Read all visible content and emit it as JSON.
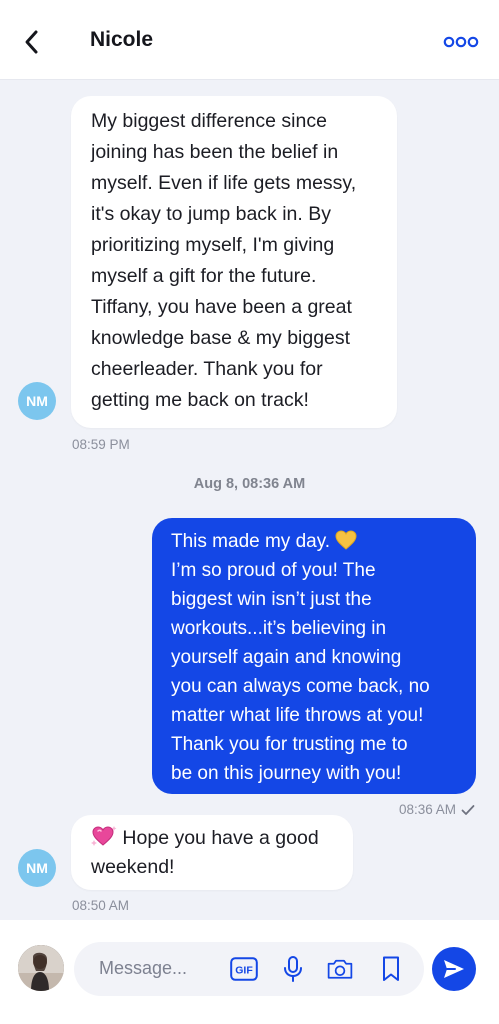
{
  "header": {
    "title": "Nicole",
    "back_icon": "chevron-left-icon",
    "more_icon": "more-dots-icon",
    "accent": "#1447e6"
  },
  "messages": [
    {
      "direction": "incoming",
      "lines": [
        "My biggest difference since",
        "joining has been the belief in",
        "myself. Even if life gets messy,",
        "it's okay to jump back in. By",
        "prioritizing myself, I'm giving",
        "myself a gift for the future.",
        "Tiffany, you have been a great",
        "knowledge base & my biggest",
        "cheerleader. Thank you for",
        "getting me back on track!"
      ],
      "avatar_initials": "NM",
      "time": "08:59 PM"
    },
    {
      "direction": "outgoing",
      "lines": [
        "This made my day.",
        "I’m so proud of you! The",
        "biggest win isn’t just the",
        "workouts...it’s believing in",
        "yourself again and knowing",
        "you can always come back, no",
        "matter what life throws at you!",
        "Thank you for trusting me to",
        "be on this journey with you!"
      ],
      "emoji": "yellow-heart-icon",
      "time": "08:36 AM",
      "status_icon": "checkmark-icon"
    },
    {
      "direction": "incoming",
      "lines": [
        "Hope you have a good",
        "weekend!"
      ],
      "emoji": "sparkling-heart-icon",
      "avatar_initials": "NM",
      "time": "08:50 AM"
    }
  ],
  "date_divider": "Aug 8, 08:36 AM",
  "composer": {
    "placeholder": "Message...",
    "gif_label": "GIF",
    "icons": [
      "gif-icon",
      "microphone-icon",
      "camera-icon",
      "bookmark-icon",
      "send-icon"
    ]
  },
  "colors": {
    "outgoing_bubble": "#1447e6",
    "incoming_bubble": "#ffffff",
    "avatar": "#7cc6ee",
    "background": "#f0f2f8"
  }
}
